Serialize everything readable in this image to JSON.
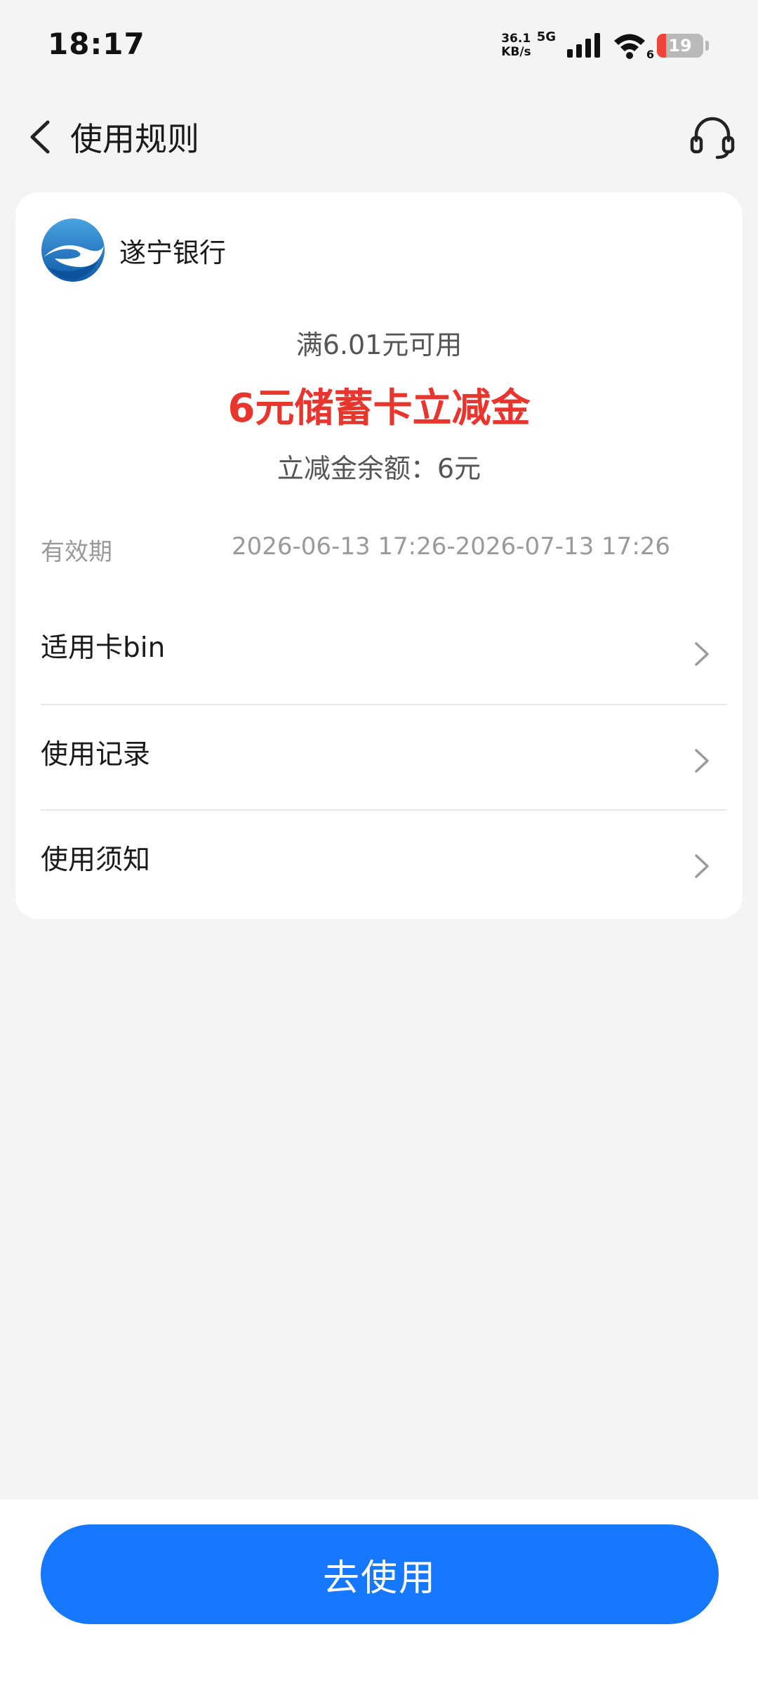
{
  "status_bar": {
    "time": "18:17",
    "net_speed_value": "36.1",
    "net_speed_unit": "KB/s",
    "network": "5G",
    "wifi_sub": "6",
    "battery": "19",
    "battery_level": 0.19
  },
  "header": {
    "title": "使用规则",
    "back_icon": "back-arrow-icon",
    "support_icon": "headset-icon"
  },
  "card": {
    "bank_name": "遂宁银行",
    "threshold": "满6.01元可用",
    "coupon_title": "6元储蓄卡立减金",
    "balance": "立减金余额：6元",
    "validity_label": "有效期",
    "validity_value": "2026-06-13 17:26-2026-07-13 17:26",
    "menu": [
      {
        "label": "适用卡bin"
      },
      {
        "label": "使用记录"
      },
      {
        "label": "使用须知"
      }
    ]
  },
  "bottom": {
    "primary_button": "去使用"
  },
  "colors": {
    "accent": "#1677ff",
    "coupon_red": "#e8362e",
    "background": "#f4f4f4"
  }
}
